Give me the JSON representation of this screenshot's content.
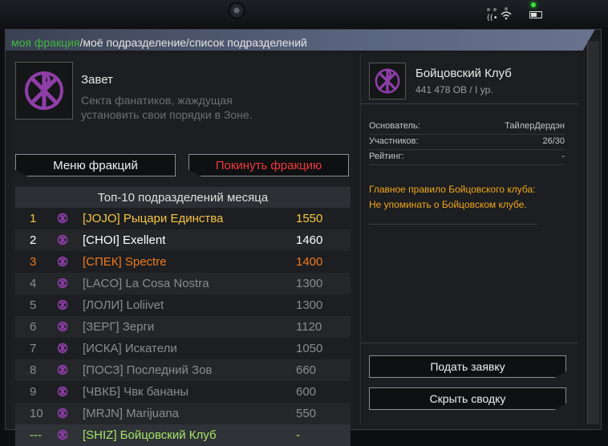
{
  "breadcrumb": {
    "active": "моя фракция",
    "sep": "/",
    "item2": "моё подразделение",
    "item3": "список подразделений"
  },
  "faction": {
    "name": "Завет",
    "description": "Секта фанатиков, жаждущая установить свои порядки в Зоне.",
    "menu_button": "Меню фракций",
    "leave_button": "Покинуть фракцию"
  },
  "top10": {
    "title": "Топ-10 подразделений месяца",
    "rows": [
      {
        "rank": "1",
        "name": "[JOJO] Рыцари Единства",
        "score": "1550",
        "color": "#f6c542"
      },
      {
        "rank": "2",
        "name": "[CHOI] Exellent",
        "score": "1460",
        "color": "#ffffff"
      },
      {
        "rank": "3",
        "name": "[СПЕК] Spectre",
        "score": "1400",
        "color": "#f07a1e"
      },
      {
        "rank": "4",
        "name": "[LACO] La Cosa Nostra",
        "score": "1300",
        "color": "#8a8c90"
      },
      {
        "rank": "5",
        "name": "[ЛОЛИ] Loliivet",
        "score": "1300",
        "color": "#8a8c90"
      },
      {
        "rank": "6",
        "name": "[ЗЕРГ] Зерги",
        "score": "1120",
        "color": "#8a8c90"
      },
      {
        "rank": "7",
        "name": "[ИСКА] Искатели",
        "score": "1050",
        "color": "#8a8c90"
      },
      {
        "rank": "8",
        "name": "[ПОСЗ] Последний Зов",
        "score": "660",
        "color": "#8a8c90"
      },
      {
        "rank": "9",
        "name": "[ЧВКБ] Чвк бананы",
        "score": "600",
        "color": "#8a8c90"
      },
      {
        "rank": "10",
        "name": "[MRJN] Marijuana",
        "score": "550",
        "color": "#8a8c90"
      },
      {
        "rank": "---",
        "name": "[SHIZ] Бойцовский Клуб",
        "score": "-",
        "color": "#a6e36a"
      }
    ]
  },
  "squad": {
    "name": "Бойцовский Клуб",
    "subtitle": "441 478 OB / I ур.",
    "founder_label": "Основатель:",
    "founder_value": "ТайлерДердэн",
    "members_label": "Участников:",
    "members_value": "26/30",
    "rating_label": "Рейтинг:",
    "rating_value": "-",
    "rule_line1": "Главное правило Бойцовского клуба:",
    "rule_line2": "Не упоминать о Бойцовском клубе.",
    "apply_button": "Подать заявку",
    "hide_button": "Скрыть сводку"
  },
  "colors": {
    "emblem": "#8f3ea8",
    "accent_green": "#3fb53f",
    "danger": "#ee3a3a",
    "rule_text": "#f0a81a"
  }
}
